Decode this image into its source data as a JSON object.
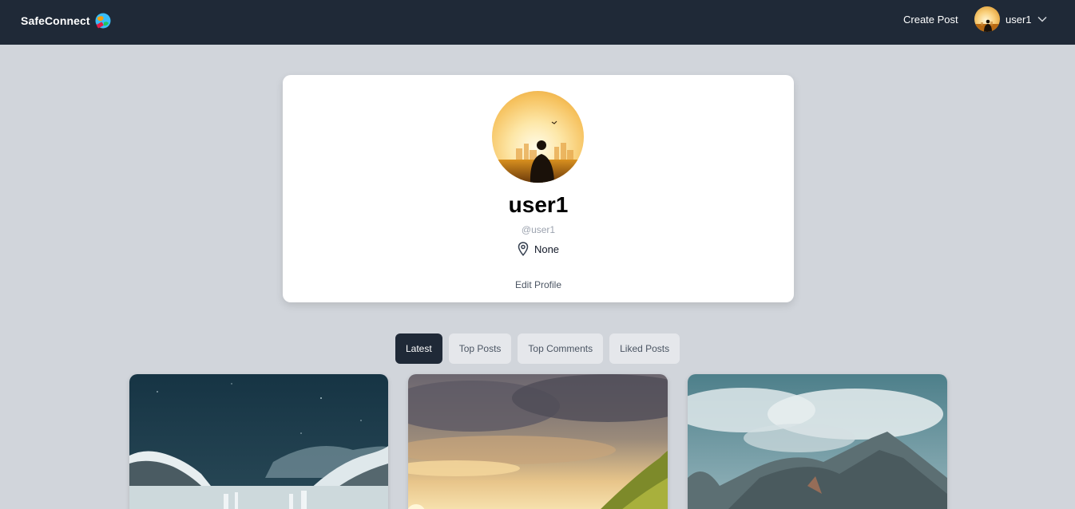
{
  "navbar": {
    "brand": "SafeConnect",
    "logo_icon": "globe-logo-icon",
    "create_post": "Create Post",
    "username": "user1",
    "avatar_icon": "user-avatar",
    "chevron_icon": "chevron-down-icon",
    "bg_color": "#1f2937"
  },
  "profile": {
    "name": "user1",
    "handle": "@user1",
    "location": "None",
    "location_icon": "map-pin-icon",
    "edit_label": "Edit Profile"
  },
  "tabs": [
    {
      "label": "Latest",
      "active": true
    },
    {
      "label": "Top Posts",
      "active": false
    },
    {
      "label": "Top Comments",
      "active": false
    },
    {
      "label": "Liked Posts",
      "active": false
    }
  ],
  "posts": [
    {
      "image": "snowy-waterfall-night"
    },
    {
      "image": "sunset-clouds-hills"
    },
    {
      "image": "cloudy-mountain-peak"
    }
  ],
  "colors": {
    "page_bg": "#d1d5db",
    "accent_dark": "#1f2937",
    "card_bg": "#ffffff"
  }
}
